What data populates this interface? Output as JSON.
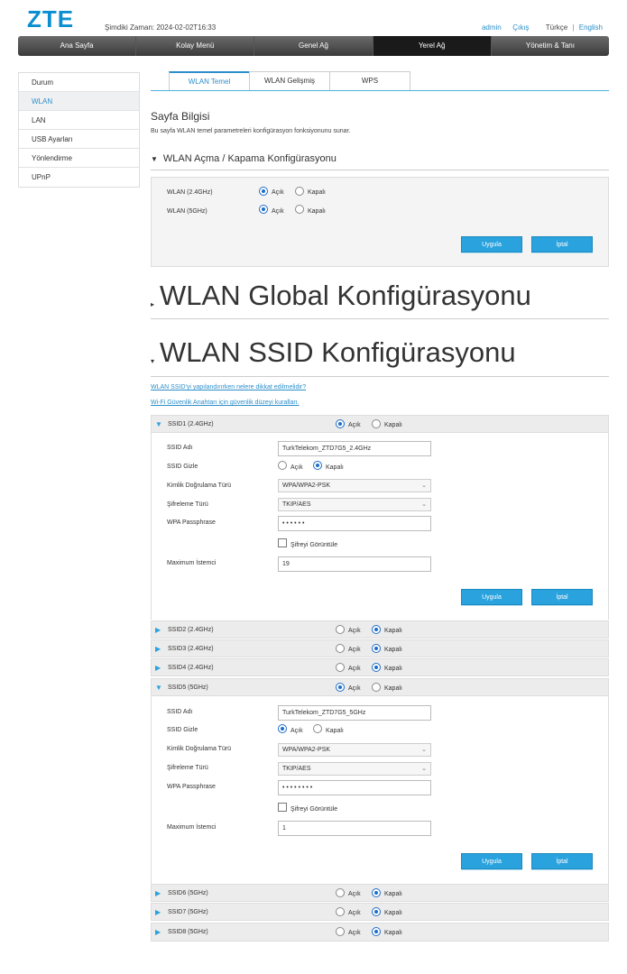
{
  "header": {
    "logo": "ZTE",
    "time": "Şimdiki Zaman: 2024-02-02T16:33",
    "user": "admin",
    "logout": "Çıkış",
    "lang_tr": "Türkçe",
    "lang_sep": "|",
    "lang_en": "English"
  },
  "nav": [
    "Ana Sayfa",
    "Kolay Menü",
    "Genel Ağ",
    "Yerel Ağ",
    "Yönetim & Tanı"
  ],
  "sidebar": [
    "Durum",
    "WLAN",
    "LAN",
    "USB Ayarları",
    "Yönlendirme",
    "UPnP"
  ],
  "tabs": [
    "WLAN Temel",
    "WLAN Gelişmiş",
    "WPS"
  ],
  "page": {
    "title": "Sayfa Bilgisi",
    "desc": "Bu sayfa WLAN temel parametreleri konfigürasyon fonksiyonunu sunar."
  },
  "onoff": {
    "header": "WLAN Açma / Kapama Konfigürasyonu",
    "wlan24_label": "WLAN (2.4GHz)",
    "wlan5_label": "WLAN (5GHz)",
    "on": "Açık",
    "off": "Kapalı",
    "apply": "Uygula",
    "cancel": "İptal"
  },
  "global_header": "WLAN Global Konfigürasyonu",
  "ssid_header": "WLAN SSID Konfigürasyonu",
  "links": {
    "l1": "WLAN SSID'yi yapılandırırken nelere dikkat edilmelidir?",
    "l2": "Wi-Fi Güvenlik Anahtarı için güvenlik düzeyi kuralları."
  },
  "labels": {
    "ssid_name": "SSID Adı",
    "ssid_hide": "SSID Gizle",
    "auth": "Kimlik Doğrulama Türü",
    "enc": "Şifreleme Türü",
    "wpa": "WPA Passphrase",
    "show_pw": "Şifreyi Görüntüle",
    "max": "Maximum İstemci",
    "on": "Açık",
    "off": "Kapalı",
    "apply": "Uygula",
    "cancel": "İptal"
  },
  "ssid1": {
    "title": "SSID1 (2.4GHz)",
    "name": "TurkTelekom_ZTD7G5_2.4GHz",
    "auth": "WPA/WPA2-PSK",
    "enc": "TKIP/AES",
    "pw": "• • • • • •",
    "max": "19"
  },
  "ssid2": {
    "title": "SSID2 (2.4GHz)"
  },
  "ssid3": {
    "title": "SSID3 (2.4GHz)"
  },
  "ssid4": {
    "title": "SSID4 (2.4GHz)"
  },
  "ssid5": {
    "title": "SSID5 (5GHz)",
    "name": "TurkTelekom_ZTD7G5_5GHz",
    "auth": "WPA/WPA2-PSK",
    "enc": "TKIP/AES",
    "pw": "• • • • • • • •",
    "max": "1"
  },
  "ssid6": {
    "title": "SSID6 (5GHz)"
  },
  "ssid7": {
    "title": "SSID7 (5GHz)"
  },
  "ssid8": {
    "title": "SSID8 (5GHz)"
  },
  "colors": {
    "accent": "#2aa2dd",
    "link": "#2c8fca",
    "nav_dark": "#3b3b3b"
  },
  "icons": {
    "expanded": "triangle-down-icon",
    "collapsed": "triangle-right-icon"
  }
}
